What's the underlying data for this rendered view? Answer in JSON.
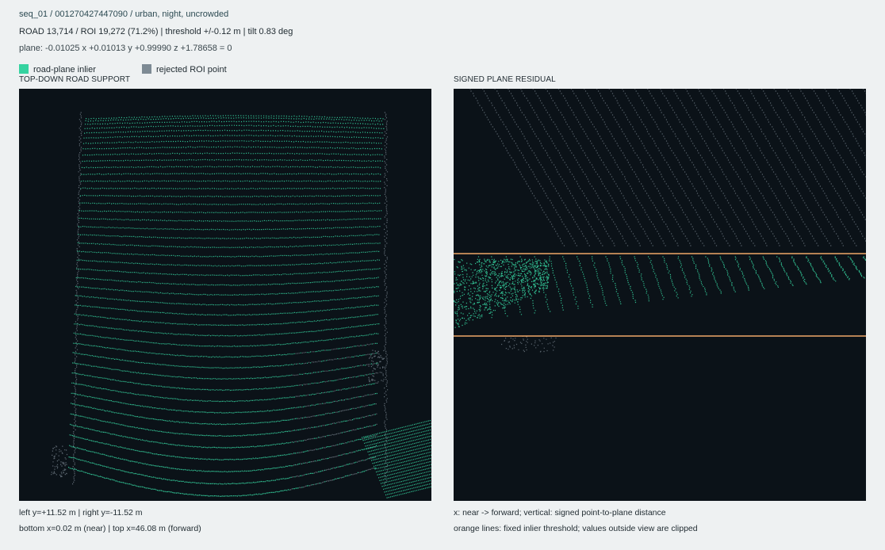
{
  "header": {
    "sequence_line": "seq_01 / 001270427447090 / urban, night, uncrowded",
    "stats_line": "ROAD 13,714 / ROI 19,272 (71.2%)  |  threshold +/-0.12 m  |  tilt 0.83 deg",
    "plane_line": "plane: -0.01025 x +0.01013 y +0.99990 z +1.78658 = 0"
  },
  "legend": {
    "items": [
      {
        "label": "road-plane inlier",
        "color": "#35d3a0"
      },
      {
        "label": "rejected ROI point",
        "color": "#7d8a94"
      }
    ]
  },
  "panels": {
    "topdown": {
      "title": "TOP-DOWN ROAD SUPPORT",
      "footer_line1": "left y=+11.52 m  |  right y=-11.52 m",
      "footer_line2": "bottom x=0.02 m (near)  |  top x=46.08 m (forward)"
    },
    "residual": {
      "title": "SIGNED PLANE RESIDUAL",
      "footer_line1": "x: near -> forward; vertical: signed point-to-plane distance",
      "footer_line2": "orange lines: fixed inlier threshold; values outside view are clipped"
    }
  },
  "colors": {
    "inlier": "#35d3a0",
    "rejected": "#7d8a94",
    "threshold": "#f0a868",
    "panel_bg": "#0b1218"
  }
}
